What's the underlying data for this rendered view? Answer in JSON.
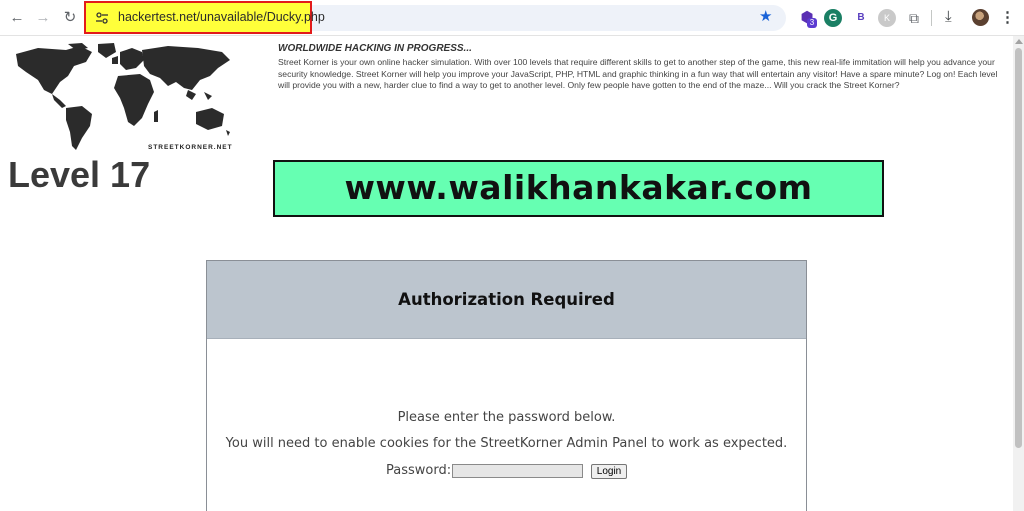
{
  "browser": {
    "url": "hackertest.net/unavailable/Ducky.php",
    "nav": {
      "back": "←",
      "forward": "→",
      "reload": "↻"
    },
    "icons": [
      "tune-icon",
      "star-icon",
      "shield-extension-icon",
      "grammarly-icon",
      "b-extension-icon",
      "k-extension-icon",
      "puzzle-icon",
      "download-icon",
      "avatar",
      "menu-icon"
    ],
    "extension_badge": "3",
    "extensions": {
      "g": "G",
      "b": "B",
      "k": "K"
    }
  },
  "site": {
    "map_caption": "STREETKORNER.NET",
    "level": "Level 17",
    "intro_title": "WORLDWIDE HACKING IN PROGRESS...",
    "intro_text": "Street Korner is your own online hacker simulation. With over 100 levels that require different skills to get to another step of the game, this new real-life immitation will help you advance your security knowledge. Street Korner will help you improve your JavaScript, PHP, HTML and graphic thinking in a fun way that will entertain any visitor! Have a spare minute? Log on! Each level will provide you with a new, harder clue to find a way to get to another level. Only few people have gotten to the end of the maze... Will you crack the Street Korner?",
    "banner": "www.walikhankakar.com"
  },
  "auth": {
    "title": "Authorization Required",
    "line1": "Please enter the password below.",
    "line2": "You will need to enable cookies for the StreetKorner Admin Panel to work as expected.",
    "password_label": "Password:",
    "password_value": "",
    "login_label": "Login"
  },
  "colors": {
    "banner_bg": "#66ffb2",
    "auth_header_bg": "#bcc5ce",
    "url_highlight": "#ffff3a",
    "url_highlight_border": "#e21b1b"
  }
}
